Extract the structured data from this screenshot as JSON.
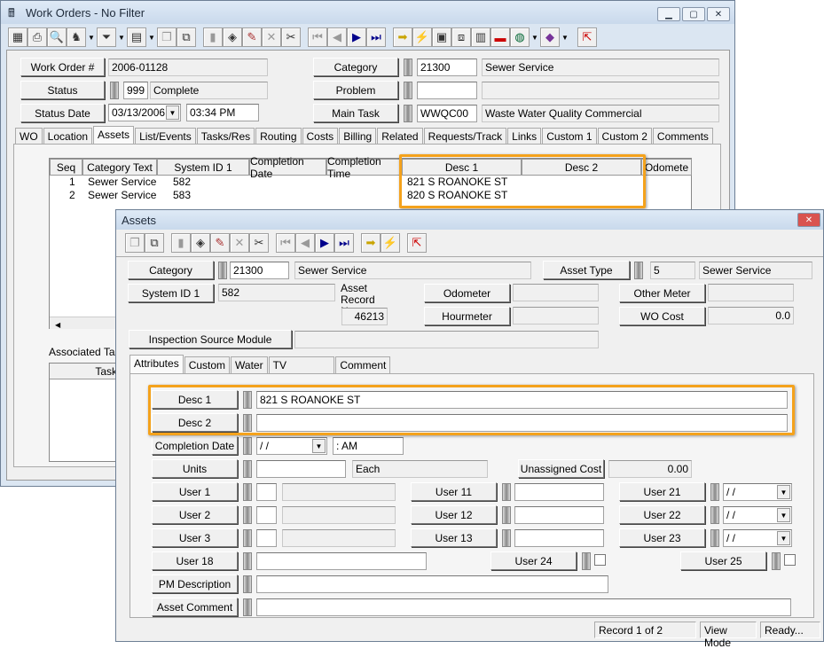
{
  "wo": {
    "title": "Work Orders - No Filter",
    "toolbar": [
      "grid-icon",
      "print-icon",
      "preview-icon",
      "user-icon",
      "dd",
      "filter-icon",
      "dd",
      "report-icon",
      "dd",
      "copy-icon",
      "duplicate-icon",
      "sep",
      "save-icon",
      "stack-icon",
      "edit-icon",
      "delete-icon",
      "cut-icon",
      "sep",
      "first-icon",
      "prev-icon",
      "next-icon",
      "last-icon",
      "sep",
      "arrow-icon",
      "lightning-icon",
      "map-icon",
      "flow-icon",
      "chart-icon",
      "toolbox-icon",
      "globe-icon",
      "dd",
      "book-icon",
      "dd",
      "sep",
      "exit-icon"
    ],
    "fields": {
      "work_order_label": "Work Order #",
      "work_order": "2006-01128",
      "status_label": "Status",
      "status_code": "999",
      "status": "Complete",
      "status_date_label": "Status Date",
      "status_date": "03/13/2006",
      "status_time": "03:34 PM",
      "category_label": "Category",
      "category_code": "21300",
      "category": "Sewer Service",
      "problem_label": "Problem",
      "problem_code": "",
      "problem": "",
      "main_task_label": "Main Task",
      "main_task_code": "WWQC00",
      "main_task": "Waste Water Quality Commercial"
    },
    "tabs": [
      "WO",
      "Location",
      "Assets",
      "List/Events",
      "Tasks/Res",
      "Routing",
      "Costs",
      "Billing",
      "Related",
      "Requests/Track",
      "Links",
      "Custom 1",
      "Custom 2",
      "Comments"
    ],
    "active_tab": "Assets",
    "grid": {
      "columns": [
        "Seq",
        "Category Text",
        "System ID 1",
        "Completion Date",
        "Completion Time",
        "Desc 1",
        "Desc 2",
        "Odomete"
      ],
      "rows": [
        [
          "1",
          "Sewer Service",
          "582",
          "",
          "",
          "821 S ROANOKE ST",
          ""
        ],
        [
          "2",
          "Sewer Service",
          "583",
          "",
          "",
          "820 S ROANOKE ST",
          ""
        ]
      ]
    },
    "associated_tasks_label": "Associated Tasks",
    "tasks_col": "Task"
  },
  "assets": {
    "title": "Assets",
    "toolbar": [
      "copy-icon",
      "duplicate-icon",
      "sep",
      "save-icon",
      "stack-icon",
      "edit-icon",
      "delete-icon",
      "cut-icon",
      "sep",
      "first-icon",
      "prev-icon",
      "next-icon",
      "last-icon",
      "sep",
      "arrow-icon",
      "lightning-icon",
      "sep",
      "exit-icon"
    ],
    "category_label": "Category",
    "category_code": "21300",
    "category": "Sewer Service",
    "asset_type_label": "Asset Type",
    "asset_type_code": "5",
    "asset_type": "Sewer Service",
    "system_id_label": "System ID 1",
    "system_id": "582",
    "record_no_label": "Asset Record No.",
    "record_no": "46213",
    "odometer_label": "Odometer",
    "odometer": "",
    "hourmeter_label": "Hourmeter",
    "hourmeter": "",
    "other_meter_label": "Other Meter",
    "other_meter": "",
    "wo_cost_label": "WO Cost",
    "wo_cost": "0.0",
    "inspection_label": "Inspection Source Module",
    "inspection": "",
    "tabs": [
      "Attributes",
      "Custom",
      "Water Meter",
      "TV Observation Data",
      "Comment"
    ],
    "active_tab": "Attributes",
    "attr": {
      "desc1_label": "Desc 1",
      "desc1": "821 S ROANOKE ST",
      "desc2_label": "Desc 2",
      "desc2": "",
      "completion_date_label": "Completion Date",
      "completion_date": " / /",
      "completion_time": " :  AM",
      "units_label": "Units",
      "units": "",
      "units_desc": "Each",
      "unassigned_cost_label": "Unassigned Cost",
      "unassigned_cost": "0.00",
      "user1_label": "User 1",
      "user2_label": "User 2",
      "user3_label": "User 3",
      "user11_label": "User 11",
      "user12_label": "User 12",
      "user13_label": "User 13",
      "user21_label": "User 21",
      "user22_label": "User 22",
      "user23_label": "User 23",
      "user21": " / /",
      "user22": " / /",
      "user23": " / /",
      "user18_label": "User 18",
      "user24_label": "User 24",
      "user25_label": "User 25",
      "pm_label": "PM Description",
      "comment_label": "Asset Comment"
    },
    "status": {
      "record": "Record 1 of 2",
      "mode": "View Mode",
      "state": "Ready..."
    }
  },
  "colors": {
    "highlight": "#f4a21c"
  }
}
